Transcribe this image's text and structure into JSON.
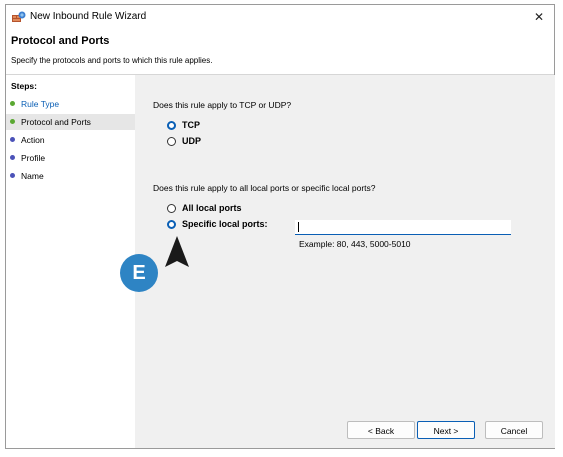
{
  "window": {
    "title": "New Inbound Rule Wizard",
    "close_glyph": "✕"
  },
  "header": {
    "title": "Protocol and Ports",
    "subtitle": "Specify the protocols and ports to which this rule applies."
  },
  "sidebar": {
    "steps_label": "Steps:",
    "items": [
      {
        "label": "Rule Type",
        "state": "completed",
        "dot_color": "#5aa832",
        "text_color": "#0a5fb5"
      },
      {
        "label": "Protocol and Ports",
        "state": "current",
        "dot_color": "#5aa832",
        "text_color": "#000000"
      },
      {
        "label": "Action",
        "state": "pending",
        "dot_color": "#4b52b8",
        "text_color": "#000000"
      },
      {
        "label": "Profile",
        "state": "pending",
        "dot_color": "#4b52b8",
        "text_color": "#000000"
      },
      {
        "label": "Name",
        "state": "pending",
        "dot_color": "#4b52b8",
        "text_color": "#000000"
      }
    ]
  },
  "main": {
    "protocol_question": "Does this rule apply to TCP or UDP?",
    "protocol_options": [
      {
        "label": "TCP",
        "selected": true
      },
      {
        "label": "UDP",
        "selected": false
      }
    ],
    "ports_question": "Does this rule apply to all local ports or specific local ports?",
    "port_options": [
      {
        "label": "All local ports",
        "selected": false
      },
      {
        "label": "Specific local ports:",
        "selected": true
      }
    ],
    "ports_input_value": "",
    "example_text": "Example: 80, 443, 5000-5010"
  },
  "buttons": {
    "back": "< Back",
    "next": "Next >",
    "cancel": "Cancel"
  },
  "annotation": {
    "badge_letter": "E",
    "badge_color": "#2e84c4"
  },
  "colors": {
    "accent": "#0a5fb5",
    "panel_bg": "#f0f0f0"
  }
}
